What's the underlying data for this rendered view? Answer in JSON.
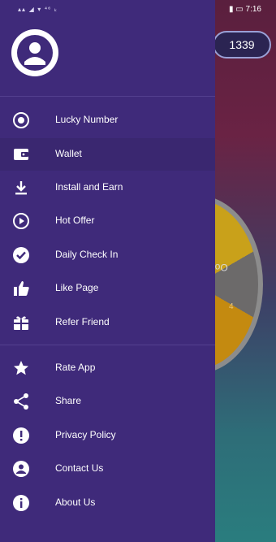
{
  "status": {
    "left": "▴▴ ◢ ▾ ⁴⁶ ₖ",
    "right": "▮ ▭ 7:16"
  },
  "coins": "1339",
  "wheel": {
    "label": "Oop",
    "label2": "4"
  },
  "drawer": {
    "items": [
      {
        "label": "Lucky Number",
        "icon": "target-icon"
      },
      {
        "label": "Wallet",
        "icon": "wallet-icon"
      },
      {
        "label": "Install and Earn",
        "icon": "download-icon"
      },
      {
        "label": "Hot Offer",
        "icon": "play-circle-icon"
      },
      {
        "label": "Daily Check In",
        "icon": "check-circle-icon"
      },
      {
        "label": "Like Page",
        "icon": "thumbs-up-icon"
      },
      {
        "label": "Refer Friend",
        "icon": "gift-icon"
      }
    ],
    "items2": [
      {
        "label": "Rate App",
        "icon": "star-icon"
      },
      {
        "label": "Share",
        "icon": "share-icon"
      },
      {
        "label": "Privacy Policy",
        "icon": "alert-icon"
      },
      {
        "label": "Contact Us",
        "icon": "account-icon"
      },
      {
        "label": "About Us",
        "icon": "info-icon"
      }
    ]
  },
  "colors": {
    "drawer": "#3f2a7a",
    "active_row": "#3a2770"
  }
}
